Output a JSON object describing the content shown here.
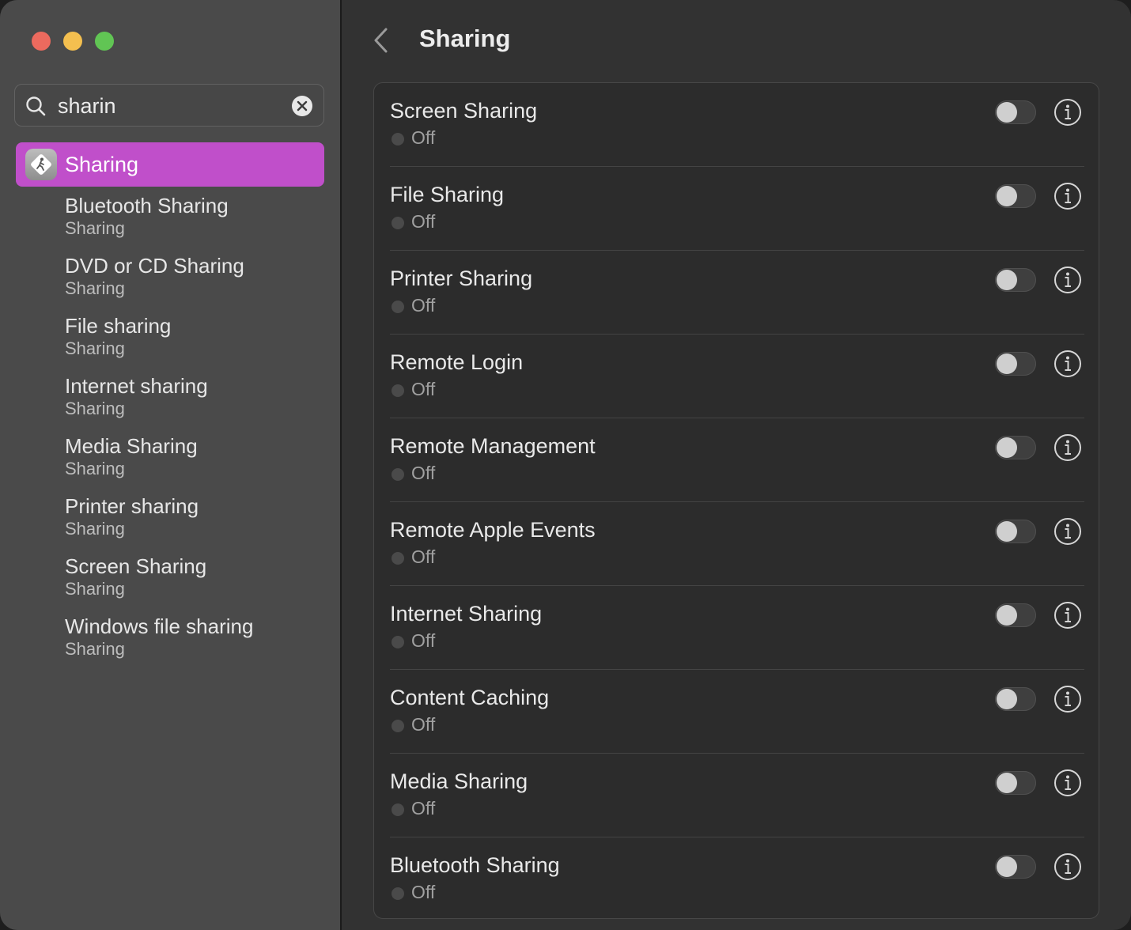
{
  "window": {
    "traffic_lights": {
      "close": "#ec6a5e",
      "minimize": "#f4bf4f",
      "zoom": "#61c554"
    }
  },
  "sidebar": {
    "search": {
      "value": "sharin",
      "icon": "magnifying-glass-icon",
      "clear_icon": "clear-x-icon"
    },
    "selected": {
      "label": "Sharing",
      "icon": "sharing-app-icon",
      "highlight_color": "#c04fca"
    },
    "results": [
      {
        "title": "Bluetooth Sharing",
        "subtitle": "Sharing"
      },
      {
        "title": "DVD or CD Sharing",
        "subtitle": "Sharing"
      },
      {
        "title": "File sharing",
        "subtitle": "Sharing"
      },
      {
        "title": "Internet sharing",
        "subtitle": "Sharing"
      },
      {
        "title": "Media Sharing",
        "subtitle": "Sharing"
      },
      {
        "title": "Printer sharing",
        "subtitle": "Sharing"
      },
      {
        "title": "Screen Sharing",
        "subtitle": "Sharing"
      },
      {
        "title": "Windows file sharing",
        "subtitle": "Sharing"
      }
    ]
  },
  "main": {
    "title": "Sharing",
    "back_icon": "chevron-left-icon",
    "services": [
      {
        "name": "Screen Sharing",
        "status": "Off",
        "enabled": false
      },
      {
        "name": "File Sharing",
        "status": "Off",
        "enabled": false
      },
      {
        "name": "Printer Sharing",
        "status": "Off",
        "enabled": false
      },
      {
        "name": "Remote Login",
        "status": "Off",
        "enabled": false
      },
      {
        "name": "Remote Management",
        "status": "Off",
        "enabled": false
      },
      {
        "name": "Remote Apple Events",
        "status": "Off",
        "enabled": false
      },
      {
        "name": "Internet Sharing",
        "status": "Off",
        "enabled": false
      },
      {
        "name": "Content Caching",
        "status": "Off",
        "enabled": false
      },
      {
        "name": "Media Sharing",
        "status": "Off",
        "enabled": false
      },
      {
        "name": "Bluetooth Sharing",
        "status": "Off",
        "enabled": false
      }
    ]
  }
}
